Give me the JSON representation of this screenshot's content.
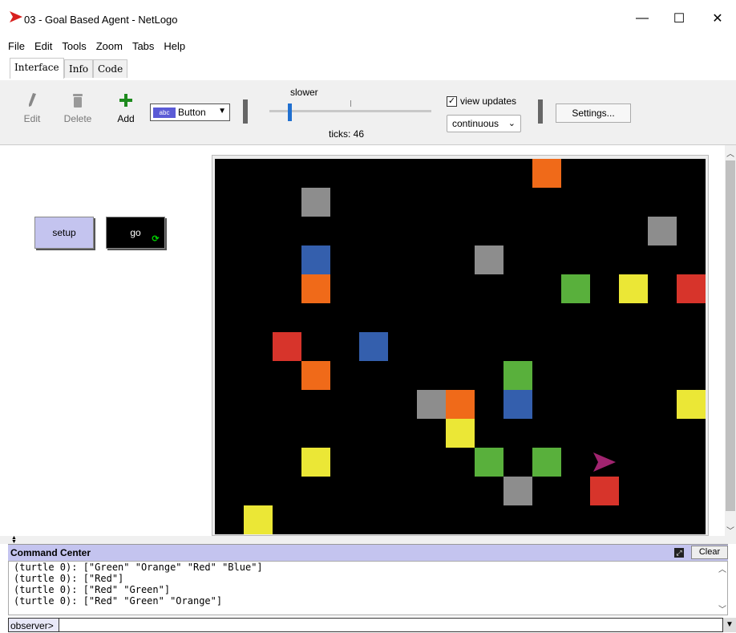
{
  "window": {
    "title": "03 - Goal Based Agent - NetLogo",
    "logo_icon": "netlogo-red-arrow-icon",
    "minimize_glyph": "—",
    "maximize_glyph": "☐",
    "close_glyph": "✕"
  },
  "menu": [
    "File",
    "Edit",
    "Tools",
    "Zoom",
    "Tabs",
    "Help"
  ],
  "tabs": [
    {
      "label": "Interface",
      "active": true
    },
    {
      "label": "Info",
      "active": false
    },
    {
      "label": "Code",
      "active": false
    }
  ],
  "toolbar": {
    "edit_label": "Edit",
    "delete_label": "Delete",
    "add_label": "Add",
    "widget_type": "Button",
    "widget_chip": "abc",
    "speed_label": "slower",
    "ticks_text": "ticks: 46",
    "view_updates_label": "view updates",
    "view_updates_checked": true,
    "update_mode": "continuous",
    "settings_label": "Settings..."
  },
  "buttons": {
    "setup_label": "setup",
    "go_label": "go"
  },
  "world": {
    "background": "#000000",
    "colors": {
      "orange": "#f06a19",
      "gray": "#8d8d8d",
      "blue": "#345fad",
      "green": "#59b03c",
      "yellow": "#ebe736",
      "red": "#d7342b",
      "turtle": "#a0246f"
    },
    "patches": [
      {
        "col": 11,
        "row": 0,
        "color": "orange"
      },
      {
        "col": 3,
        "row": 1,
        "color": "gray"
      },
      {
        "col": 15,
        "row": 2,
        "color": "gray"
      },
      {
        "col": 3,
        "row": 3,
        "color": "blue"
      },
      {
        "col": 9,
        "row": 3,
        "color": "gray"
      },
      {
        "col": 3,
        "row": 4,
        "color": "orange"
      },
      {
        "col": 12,
        "row": 4,
        "color": "green"
      },
      {
        "col": 14,
        "row": 4,
        "color": "yellow"
      },
      {
        "col": 16,
        "row": 4,
        "color": "red"
      },
      {
        "col": 2,
        "row": 6,
        "color": "red"
      },
      {
        "col": 5,
        "row": 6,
        "color": "blue"
      },
      {
        "col": 3,
        "row": 7,
        "color": "orange"
      },
      {
        "col": 10,
        "row": 7,
        "color": "green"
      },
      {
        "col": 7,
        "row": 8,
        "color": "gray"
      },
      {
        "col": 8,
        "row": 8,
        "color": "orange"
      },
      {
        "col": 10,
        "row": 8,
        "color": "blue"
      },
      {
        "col": 16,
        "row": 8,
        "color": "yellow"
      },
      {
        "col": 8,
        "row": 9,
        "color": "yellow"
      },
      {
        "col": 3,
        "row": 10,
        "color": "yellow"
      },
      {
        "col": 9,
        "row": 10,
        "color": "green"
      },
      {
        "col": 11,
        "row": 10,
        "color": "green"
      },
      {
        "col": 10,
        "row": 11,
        "color": "gray"
      },
      {
        "col": 13,
        "row": 11,
        "color": "red"
      },
      {
        "col": 1,
        "row": 12,
        "color": "yellow"
      }
    ],
    "turtle": {
      "col": 13,
      "row": 10,
      "heading": "east",
      "color": "turtle"
    }
  },
  "command_center": {
    "title": "Command Center",
    "clear_label": "Clear",
    "output": [
      "(turtle 0): [\"Green\" \"Orange\" \"Red\" \"Blue\"]",
      "(turtle 0): [\"Red\"]",
      "(turtle 0): [\"Red\" \"Green\"]",
      "(turtle 0): [\"Red\" \"Green\" \"Orange\"]"
    ],
    "prompt_label": "observer>",
    "input_value": ""
  }
}
